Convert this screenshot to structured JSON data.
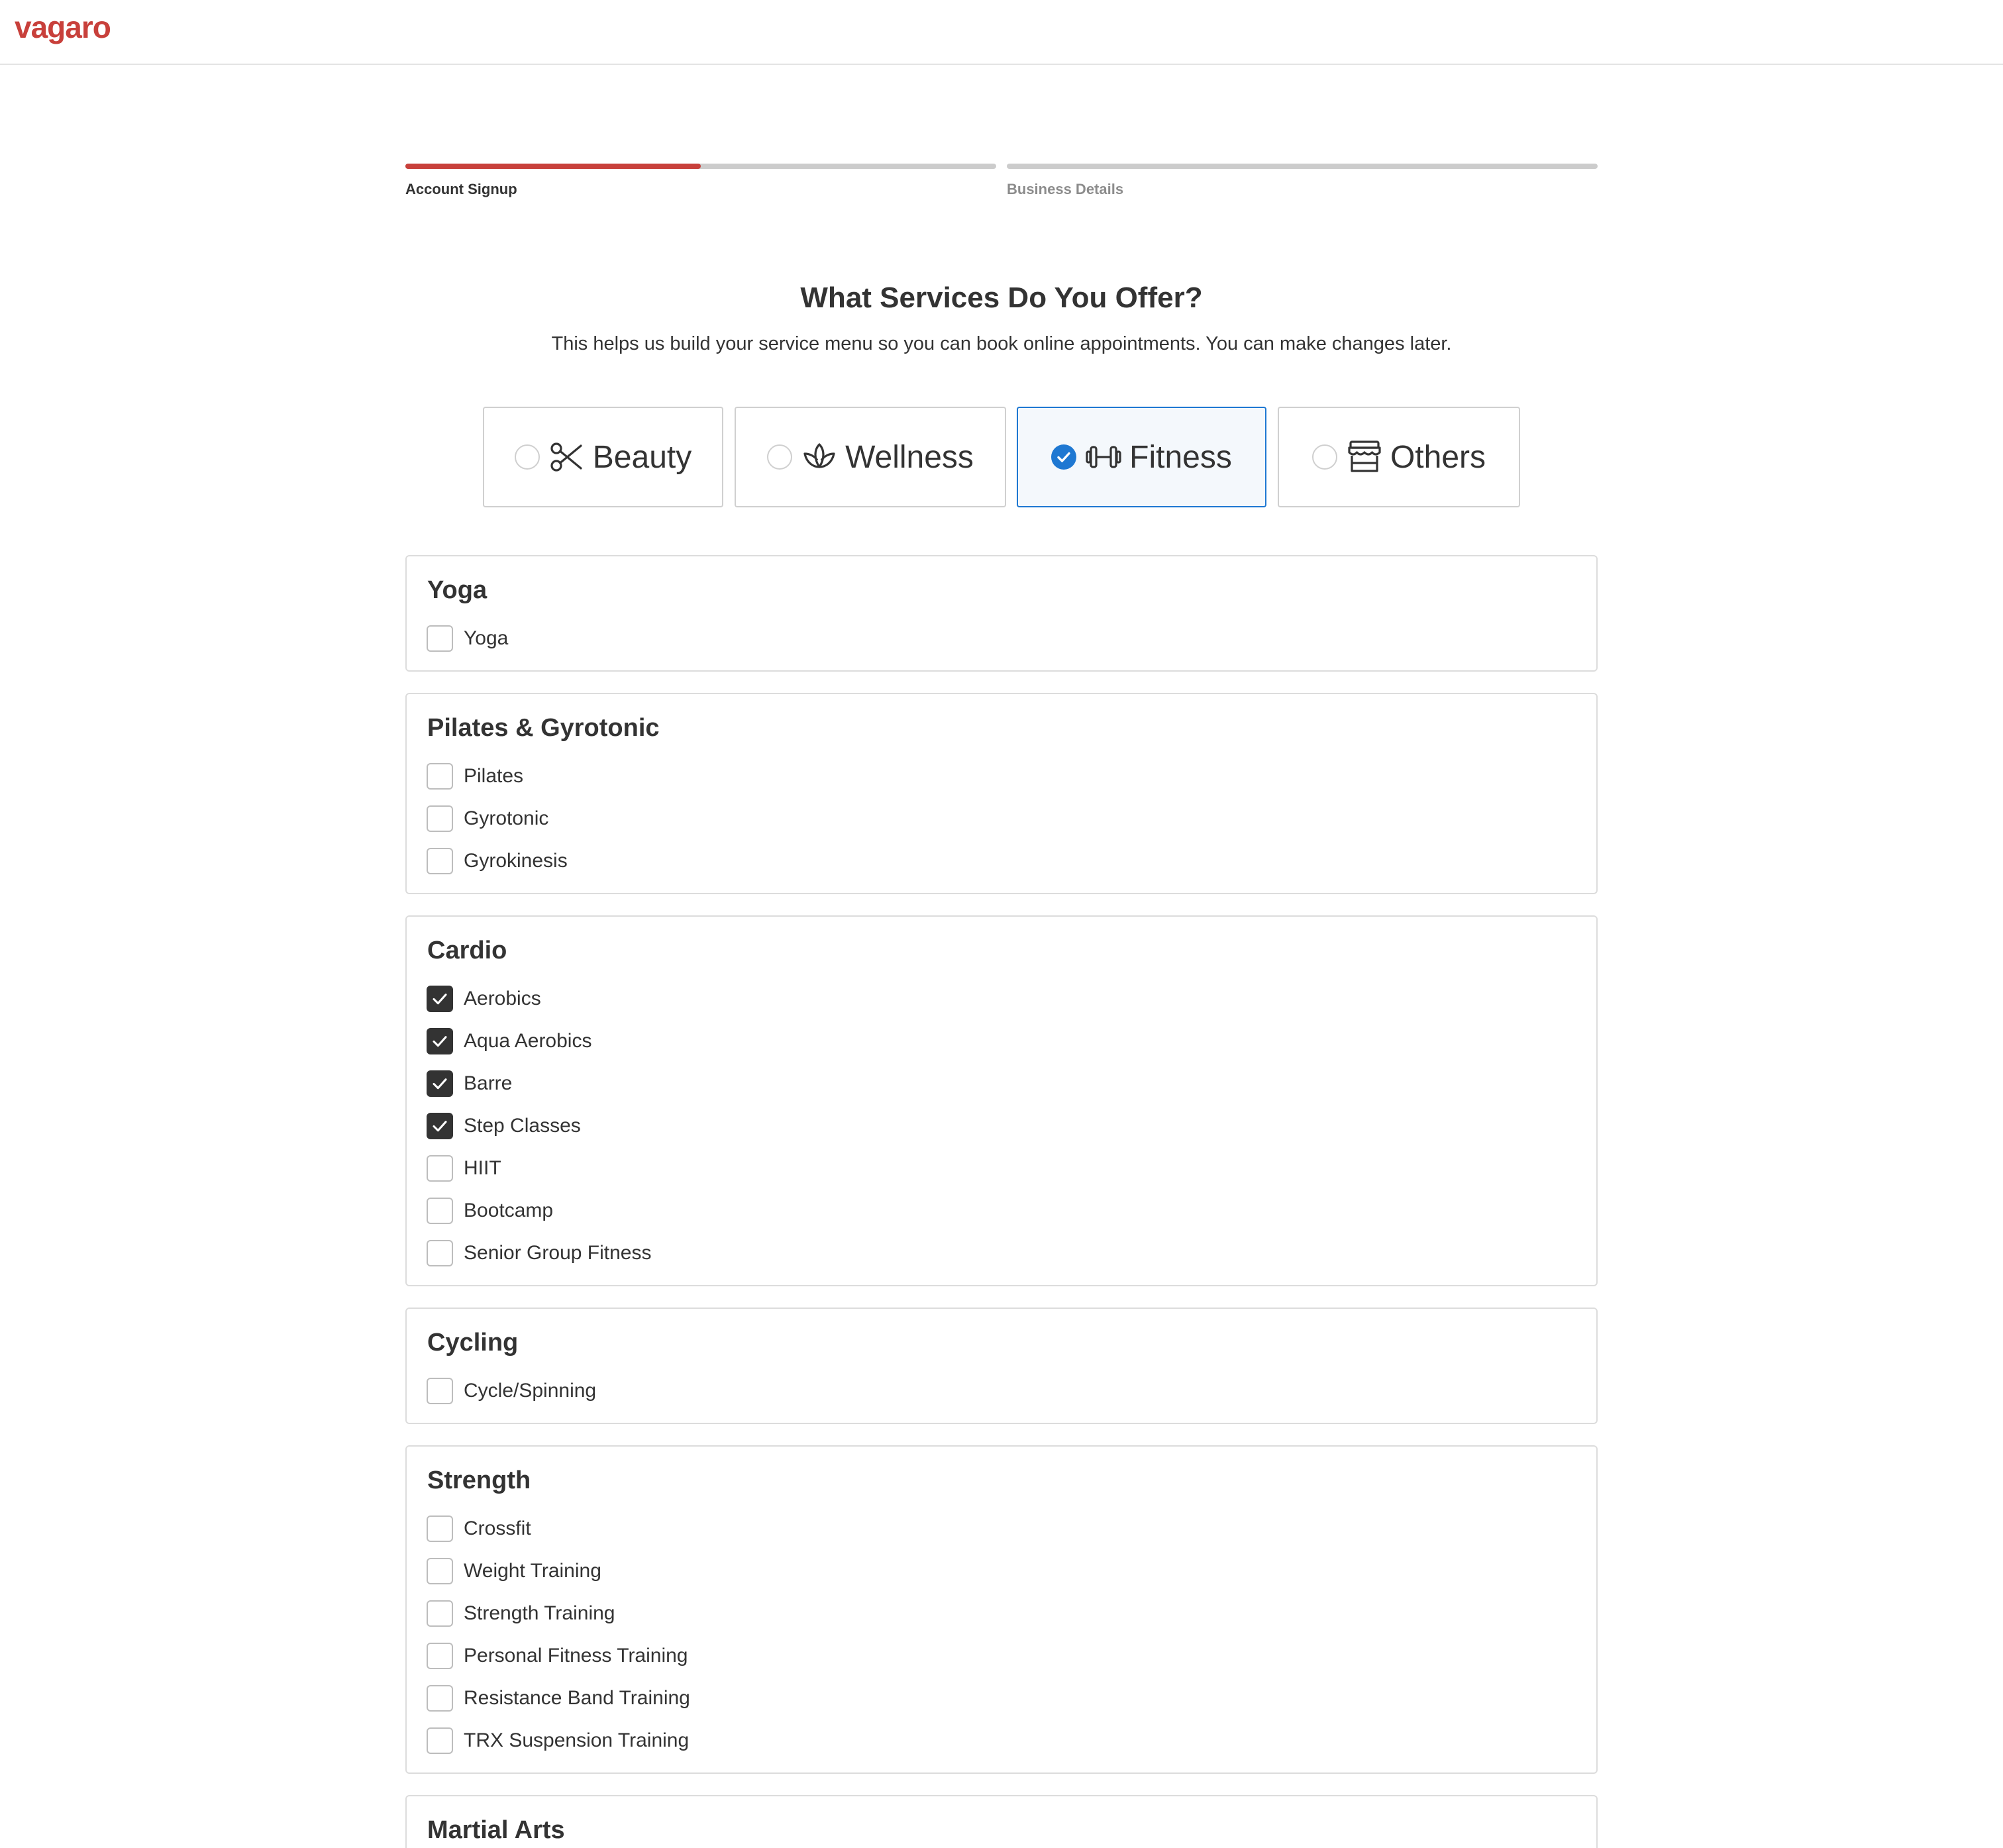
{
  "brand": {
    "logo_text": "vagaro",
    "accent_color": "#c8403b"
  },
  "progress": {
    "steps": [
      {
        "label": "Account Signup",
        "completion": 0.5,
        "active": true
      },
      {
        "label": "Business Details",
        "completion": 0,
        "active": false
      }
    ]
  },
  "heading": {
    "title": "What Services Do You Offer?",
    "subtitle": "This helps us build your service menu so you can book online appointments. You can make changes later."
  },
  "categories": [
    {
      "label": "Beauty",
      "icon": "scissors-icon",
      "selected": false
    },
    {
      "label": "Wellness",
      "icon": "lotus-icon",
      "selected": false
    },
    {
      "label": "Fitness",
      "icon": "dumbbell-icon",
      "selected": true
    },
    {
      "label": "Others",
      "icon": "storefront-icon",
      "selected": false
    }
  ],
  "selection_color": "#1e78d2",
  "groups": [
    {
      "title": "Yoga",
      "options": [
        {
          "label": "Yoga",
          "checked": false
        }
      ]
    },
    {
      "title": "Pilates & Gyrotonic",
      "options": [
        {
          "label": "Pilates",
          "checked": false
        },
        {
          "label": "Gyrotonic",
          "checked": false
        },
        {
          "label": "Gyrokinesis",
          "checked": false
        }
      ]
    },
    {
      "title": "Cardio",
      "options": [
        {
          "label": "Aerobics",
          "checked": true
        },
        {
          "label": "Aqua Aerobics",
          "checked": true
        },
        {
          "label": "Barre",
          "checked": true
        },
        {
          "label": "Step Classes",
          "checked": true
        },
        {
          "label": "HIIT",
          "checked": false
        },
        {
          "label": "Bootcamp",
          "checked": false
        },
        {
          "label": "Senior Group Fitness",
          "checked": false
        }
      ]
    },
    {
      "title": "Cycling",
      "options": [
        {
          "label": "Cycle/Spinning",
          "checked": false
        }
      ]
    },
    {
      "title": "Strength",
      "options": [
        {
          "label": "Crossfit",
          "checked": false
        },
        {
          "label": "Weight Training",
          "checked": false
        },
        {
          "label": "Strength Training",
          "checked": false
        },
        {
          "label": "Personal Fitness Training",
          "checked": false
        },
        {
          "label": "Resistance Band Training",
          "checked": false
        },
        {
          "label": "TRX Suspension Training",
          "checked": false
        }
      ]
    },
    {
      "title": "Martial Arts",
      "options": []
    }
  ]
}
